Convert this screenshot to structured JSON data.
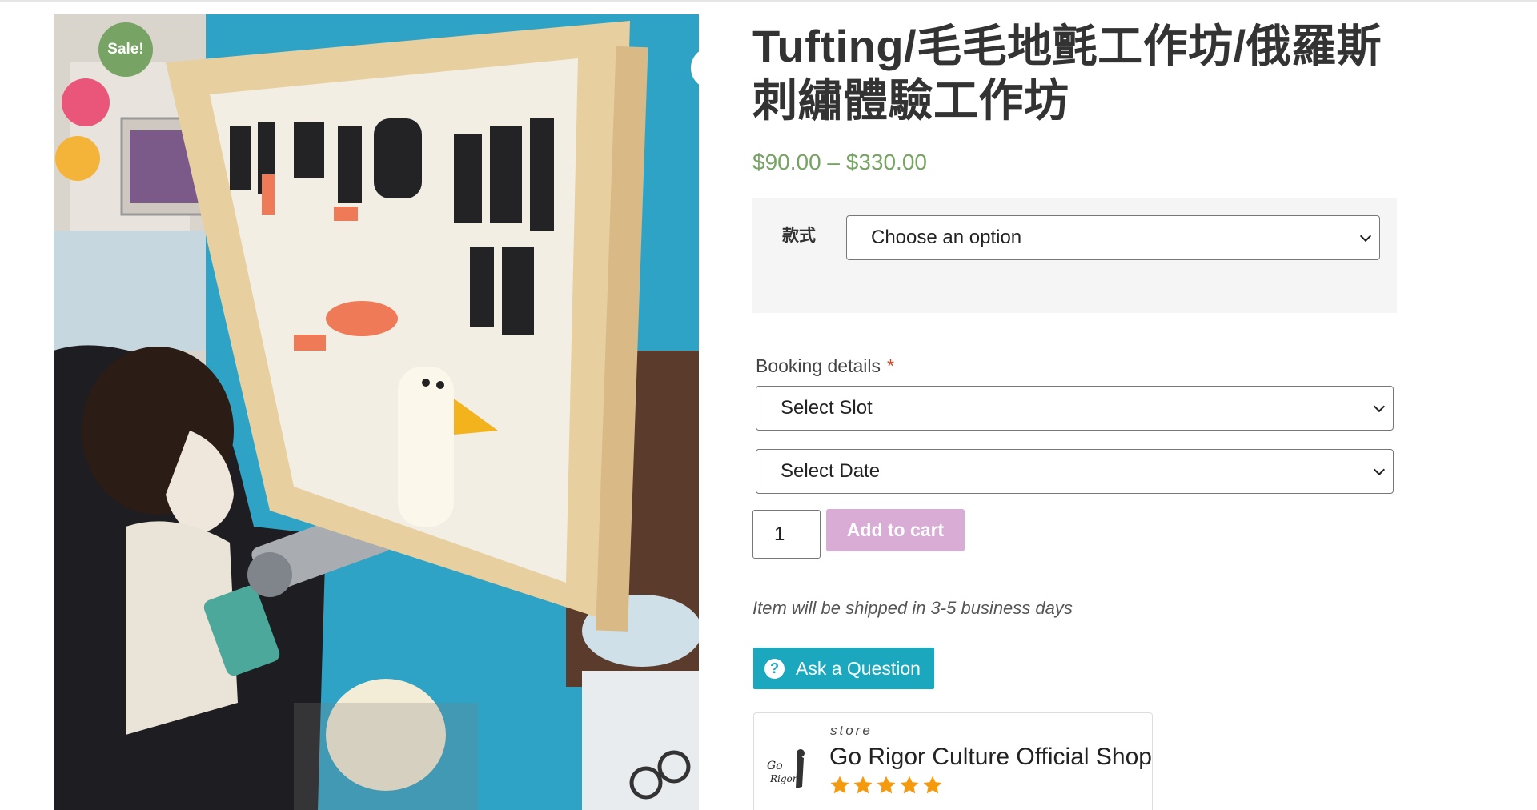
{
  "gallery": {
    "sale_badge": "Sale!",
    "zoom_icon": "magnifier-icon"
  },
  "product": {
    "title_line1": "Tufting/毛毛地氈工作坊/俄羅斯",
    "title_line2": "刺繡體驗工作坊",
    "price": "$90.00 – $330.00",
    "variation_label": "款式",
    "variation_selected": "Choose an option",
    "booking_label": "Booking details",
    "required_mark": "*",
    "slot_selected": "Select Slot",
    "date_selected": "Select Date",
    "quantity": "1",
    "add_to_cart": "Add to cart",
    "shipping_note": "Item will be shipped in 3-5 business days",
    "ask_question": "Ask a Question"
  },
  "store": {
    "label": "store",
    "name": "Go Rigor Culture Official Shop",
    "rating": 5,
    "rating_max": 5
  },
  "colors": {
    "sale_green": "#77a464",
    "price_green": "#77a464",
    "add_to_cart_pink": "#d8acd4",
    "ask_button_teal": "#1ba8bf",
    "star_orange": "#f59a0c"
  }
}
